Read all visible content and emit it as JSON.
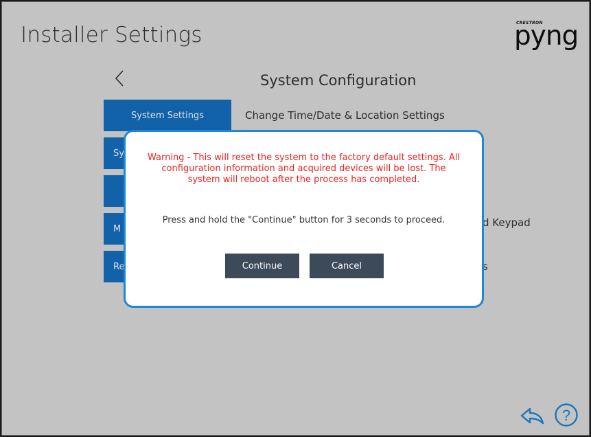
{
  "header": {
    "title": "Installer Settings",
    "logo_small": "CRESTRON",
    "logo_main": "pyng"
  },
  "nav": {
    "back_icon": "chevron-left-icon",
    "section_title": "System Configuration"
  },
  "menu": {
    "items": [
      {
        "label": "System Settings",
        "description": "Change Time/Date & Location Settings"
      },
      {
        "label": "Sy",
        "description": ""
      },
      {
        "label": "",
        "description": ""
      },
      {
        "label": "M",
        "description": "d Keypad"
      },
      {
        "label": "Re",
        "description": "s"
      }
    ]
  },
  "footer": {
    "share_icon": "back-arrow-icon",
    "help_icon": "help-circle-icon"
  },
  "dialog": {
    "warning": "Warning - This will reset the system to the factory default settings. All configuration information and acquired devices will be lost. The system will reboot after the process has completed.",
    "instruction": "Press and hold the \"Continue\" button for 3 seconds to proceed.",
    "continue_label": "Continue",
    "cancel_label": "Cancel"
  },
  "colors": {
    "accent_blue": "#1570c2",
    "dialog_border": "#1e87d8",
    "warning_red": "#e8241f",
    "dialog_button": "#3d4a5a",
    "background": "#dedede"
  }
}
